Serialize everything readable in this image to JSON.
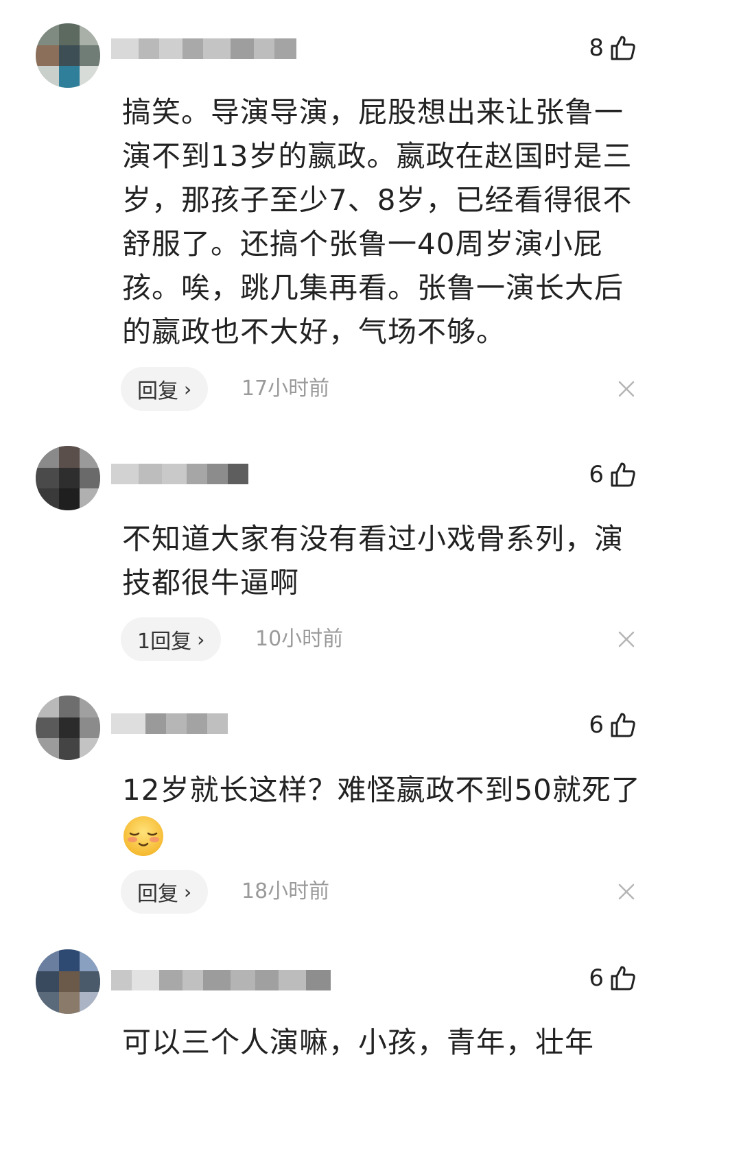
{
  "comments": [
    {
      "likes": "8",
      "text": "搞笑。导演导演，屁股想出来让张鲁一演不到13岁的嬴政。嬴政在赵国时是三岁，那孩子至少7、8岁，已经看得很不舒服了。还搞个张鲁一40周岁演小屁孩。唉，跳几集再看。张鲁一演长大后的嬴政也不大好，气场不够。",
      "reply_label": "回复",
      "time": "17小时前"
    },
    {
      "likes": "6",
      "text": "不知道大家有没有看过小戏骨系列，演技都很牛逼啊",
      "reply_label": "1回复",
      "time": "10小时前"
    },
    {
      "likes": "6",
      "text": "12岁就长这样？难怪嬴政不到50就死了",
      "emoji": "shy-smile-emoji",
      "reply_label": "回复",
      "time": "18小时前"
    },
    {
      "likes": "6",
      "text": "可以三个人演嘛，小孩，青年，壮年"
    }
  ],
  "icons": {
    "like": "thumbs-up-icon",
    "close": "close-icon",
    "chevron": "chevron-right-icon"
  },
  "colors": {
    "text": "#222222",
    "muted": "#9a9a9a",
    "pill": "#f3f3f3"
  }
}
